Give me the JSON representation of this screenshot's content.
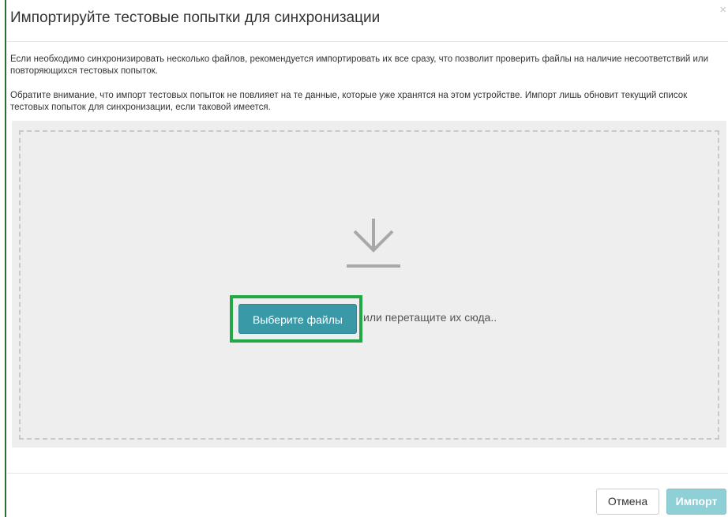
{
  "dialog": {
    "title": "Импортируйте тестовые попытки для синхронизации",
    "close_glyph": "×",
    "paragraph1": "Если необходимо синхронизировать несколько файлов, рекомендуется импортировать их все сразу, что позволит проверить файлы на наличие несоответствий или повторяющихся тестовых попыток.",
    "paragraph2": "Обратите внимание, что импорт тестовых попыток не повлияет на те данные, которые уже хранятся на этом устройстве. Импорт лишь обновит текущий список тестовых попыток для синхронизации, если таковой имеется."
  },
  "dropzone": {
    "icon": "download-arrow-icon",
    "choose_button_label": "Выберите файлы",
    "drop_hint": "или перетащите их сюда.."
  },
  "footer": {
    "cancel_label": "Отмена",
    "import_label": "Импорт"
  },
  "colors": {
    "accent_teal": "#3a99a7",
    "import_disabled": "#8fcfd6",
    "highlight_green": "#22a847",
    "dropzone_bg": "#eeeeee"
  }
}
